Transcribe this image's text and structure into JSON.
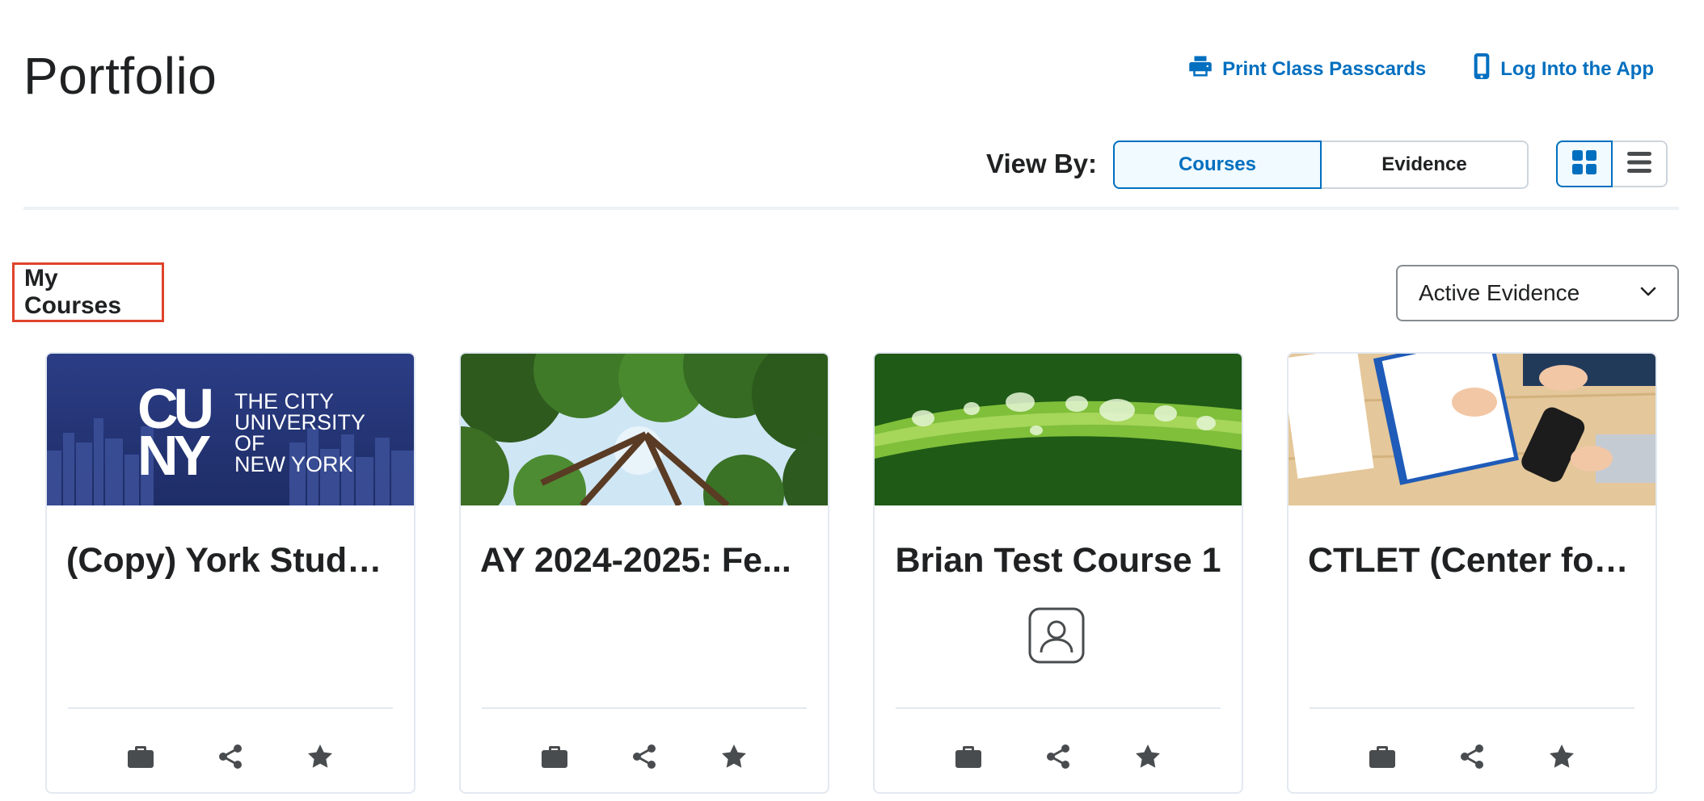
{
  "page": {
    "title": "Portfolio"
  },
  "header_links": {
    "print": {
      "label": "Print Class Passcards",
      "icon": "printer-icon"
    },
    "app": {
      "label": "Log Into the App",
      "icon": "mobile-phone-icon"
    }
  },
  "view_by": {
    "label": "View By:",
    "options": [
      "Courses",
      "Evidence"
    ],
    "selected": "Courses"
  },
  "layout_toggle": {
    "options": [
      "grid-icon",
      "list-icon"
    ],
    "selected": "grid-icon"
  },
  "section": {
    "heading": "My Courses"
  },
  "filter": {
    "selected": "Active Evidence"
  },
  "cards": [
    {
      "title": "(Copy) York Studen...",
      "image": "cuny-skyline",
      "image_text": [
        "CU",
        "NY",
        "THE CITY",
        "UNIVERSITY",
        "OF",
        "NEW YORK"
      ]
    },
    {
      "title": "AY 2024-2025: Fe...",
      "image": "forest-canopy"
    },
    {
      "title": "Brian Test Course 1",
      "image": "leaf-water-drops",
      "badge": "user-profile-icon"
    },
    {
      "title": "CTLET (Center for ...",
      "image": "desk-writing"
    }
  ],
  "card_actions": [
    "briefcase-icon",
    "share-icon",
    "star-icon"
  ],
  "colors": {
    "accent": "#006fbf",
    "highlight_border": "#e0432b",
    "text": "#202122"
  }
}
